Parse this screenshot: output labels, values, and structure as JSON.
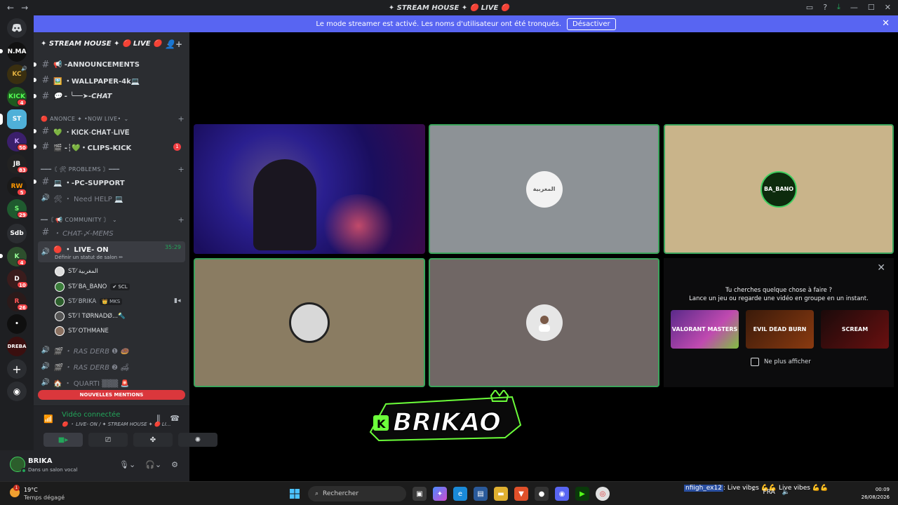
{
  "window": {
    "title": "✦ STREAM HOUSE ✦ 🔴 LIVE 🔴"
  },
  "banner": {
    "text": "Le mode streamer est activé. Les noms d'utilisateur ont été tronqués.",
    "button": "Désactiver"
  },
  "rail": {
    "servers": [
      {
        "label": "N.MA"
      },
      {
        "label": "KC",
        "badge": ""
      },
      {
        "label": "KICK",
        "badge": "4"
      },
      {
        "label": "ST"
      },
      {
        "label": "K",
        "badge": "50"
      },
      {
        "label": "JB",
        "badge": "83"
      },
      {
        "label": "RW",
        "badge": "5"
      },
      {
        "label": "S",
        "badge": "29"
      },
      {
        "label": "Sdb"
      },
      {
        "label": "K",
        "badge": "4"
      },
      {
        "label": "D",
        "badge": "10"
      },
      {
        "label": "R",
        "badge": "26"
      },
      {
        "label": "•"
      },
      {
        "label": "DREBA"
      }
    ]
  },
  "server": {
    "name": "✦ STREAM HOUSE ✦ 🔴 LIVE 🔴"
  },
  "channels": {
    "announcements": "📢 -ANNOUNCEMENTS",
    "wallpaper": "🖼️ ・WALLPAPER-4k💻",
    "chat": "💬 - ╰──➤-CHAT",
    "cat_live": "🔴 ANONCE ✦ •NOW LIVE•",
    "kick_chat": "💚 ・𝐊𝐈𝐂𝐊-𝐂𝐇𝐀𝐓-𝐋𝐈𝐕𝐄",
    "clips": "🎬 -┆💚・CLIPS-KICK",
    "clips_badge": "1",
    "cat_problems": "━━━〘 🛠 PROBLEMS 〙━━━",
    "pc_support": "💻 ・-PC-SUPPORT",
    "need_help": "🛠 ・ Need HELP 💻",
    "cat_community": "━━〘 📢 COMMUNITY 〙",
    "chat_mems": "・ CHAT-〆-MEMS",
    "live_on": "🔴 ・ LIVE- ON",
    "live_time": "35:29",
    "live_status": "Définir un statut de salon ✏",
    "voice_users": [
      {
        "name": "ST⁄ المغربية"
      },
      {
        "name": "ST⁄ BA_BANO",
        "tag": "✔ SCL"
      },
      {
        "name": "ST⁄ BRIKA",
        "tag": "👑 MKS"
      },
      {
        "name": "ST⁄ l TØRNADØ...🔦"
      },
      {
        "name": "ST⁄ OTHMANE"
      }
    ],
    "ras_derb_1": "🎬 ・ RAS DERB ❶ 🍩",
    "ras_derb_2": "🎬 ・ RAS DERB ❷ 🛋",
    "quarti": "🏠 ・ QUARTI ▒▒▒ 🚨",
    "mentions": "NOUVELLES MENTIONS"
  },
  "voice": {
    "status": "Vidéo connectée",
    "sub": "🔴 ・ LIVE- ON / ✦ STREAM HOUSE ✦ 🔴 LI..."
  },
  "user": {
    "name": "BRIKA",
    "status": "Dans un salon vocal"
  },
  "tiles": [
    {
      "label": "camera-feed"
    },
    {
      "label": "المغربية",
      "color": "#8d9296"
    },
    {
      "label": "BA_BANO",
      "color": "#c9b48a"
    },
    {
      "label": "",
      "color": "#8a7c62"
    },
    {
      "label": "",
      "color": "#706765"
    }
  ],
  "activity": {
    "title_1": "Tu cherches quelque chose à faire ?",
    "title_2": "Lance un jeu ou regarde une vidéo en groupe en un instant.",
    "cards": [
      "VALORANT MASTERS",
      "EVIL DEAD BURN",
      "SCREAM"
    ],
    "option": "Ne plus afficher"
  },
  "overlay": {
    "logo_text": "BRIKAO"
  },
  "taskbar": {
    "temp": "19°C",
    "weather": "Temps dégagé",
    "search": "Rechercher",
    "ticker_user": "nfiigh_ex12",
    "ticker_text": ": Live vibes 💪💪 Live vibes 💪💪",
    "lang": "FRA",
    "time": "00:09",
    "date": "26/08/2026"
  }
}
